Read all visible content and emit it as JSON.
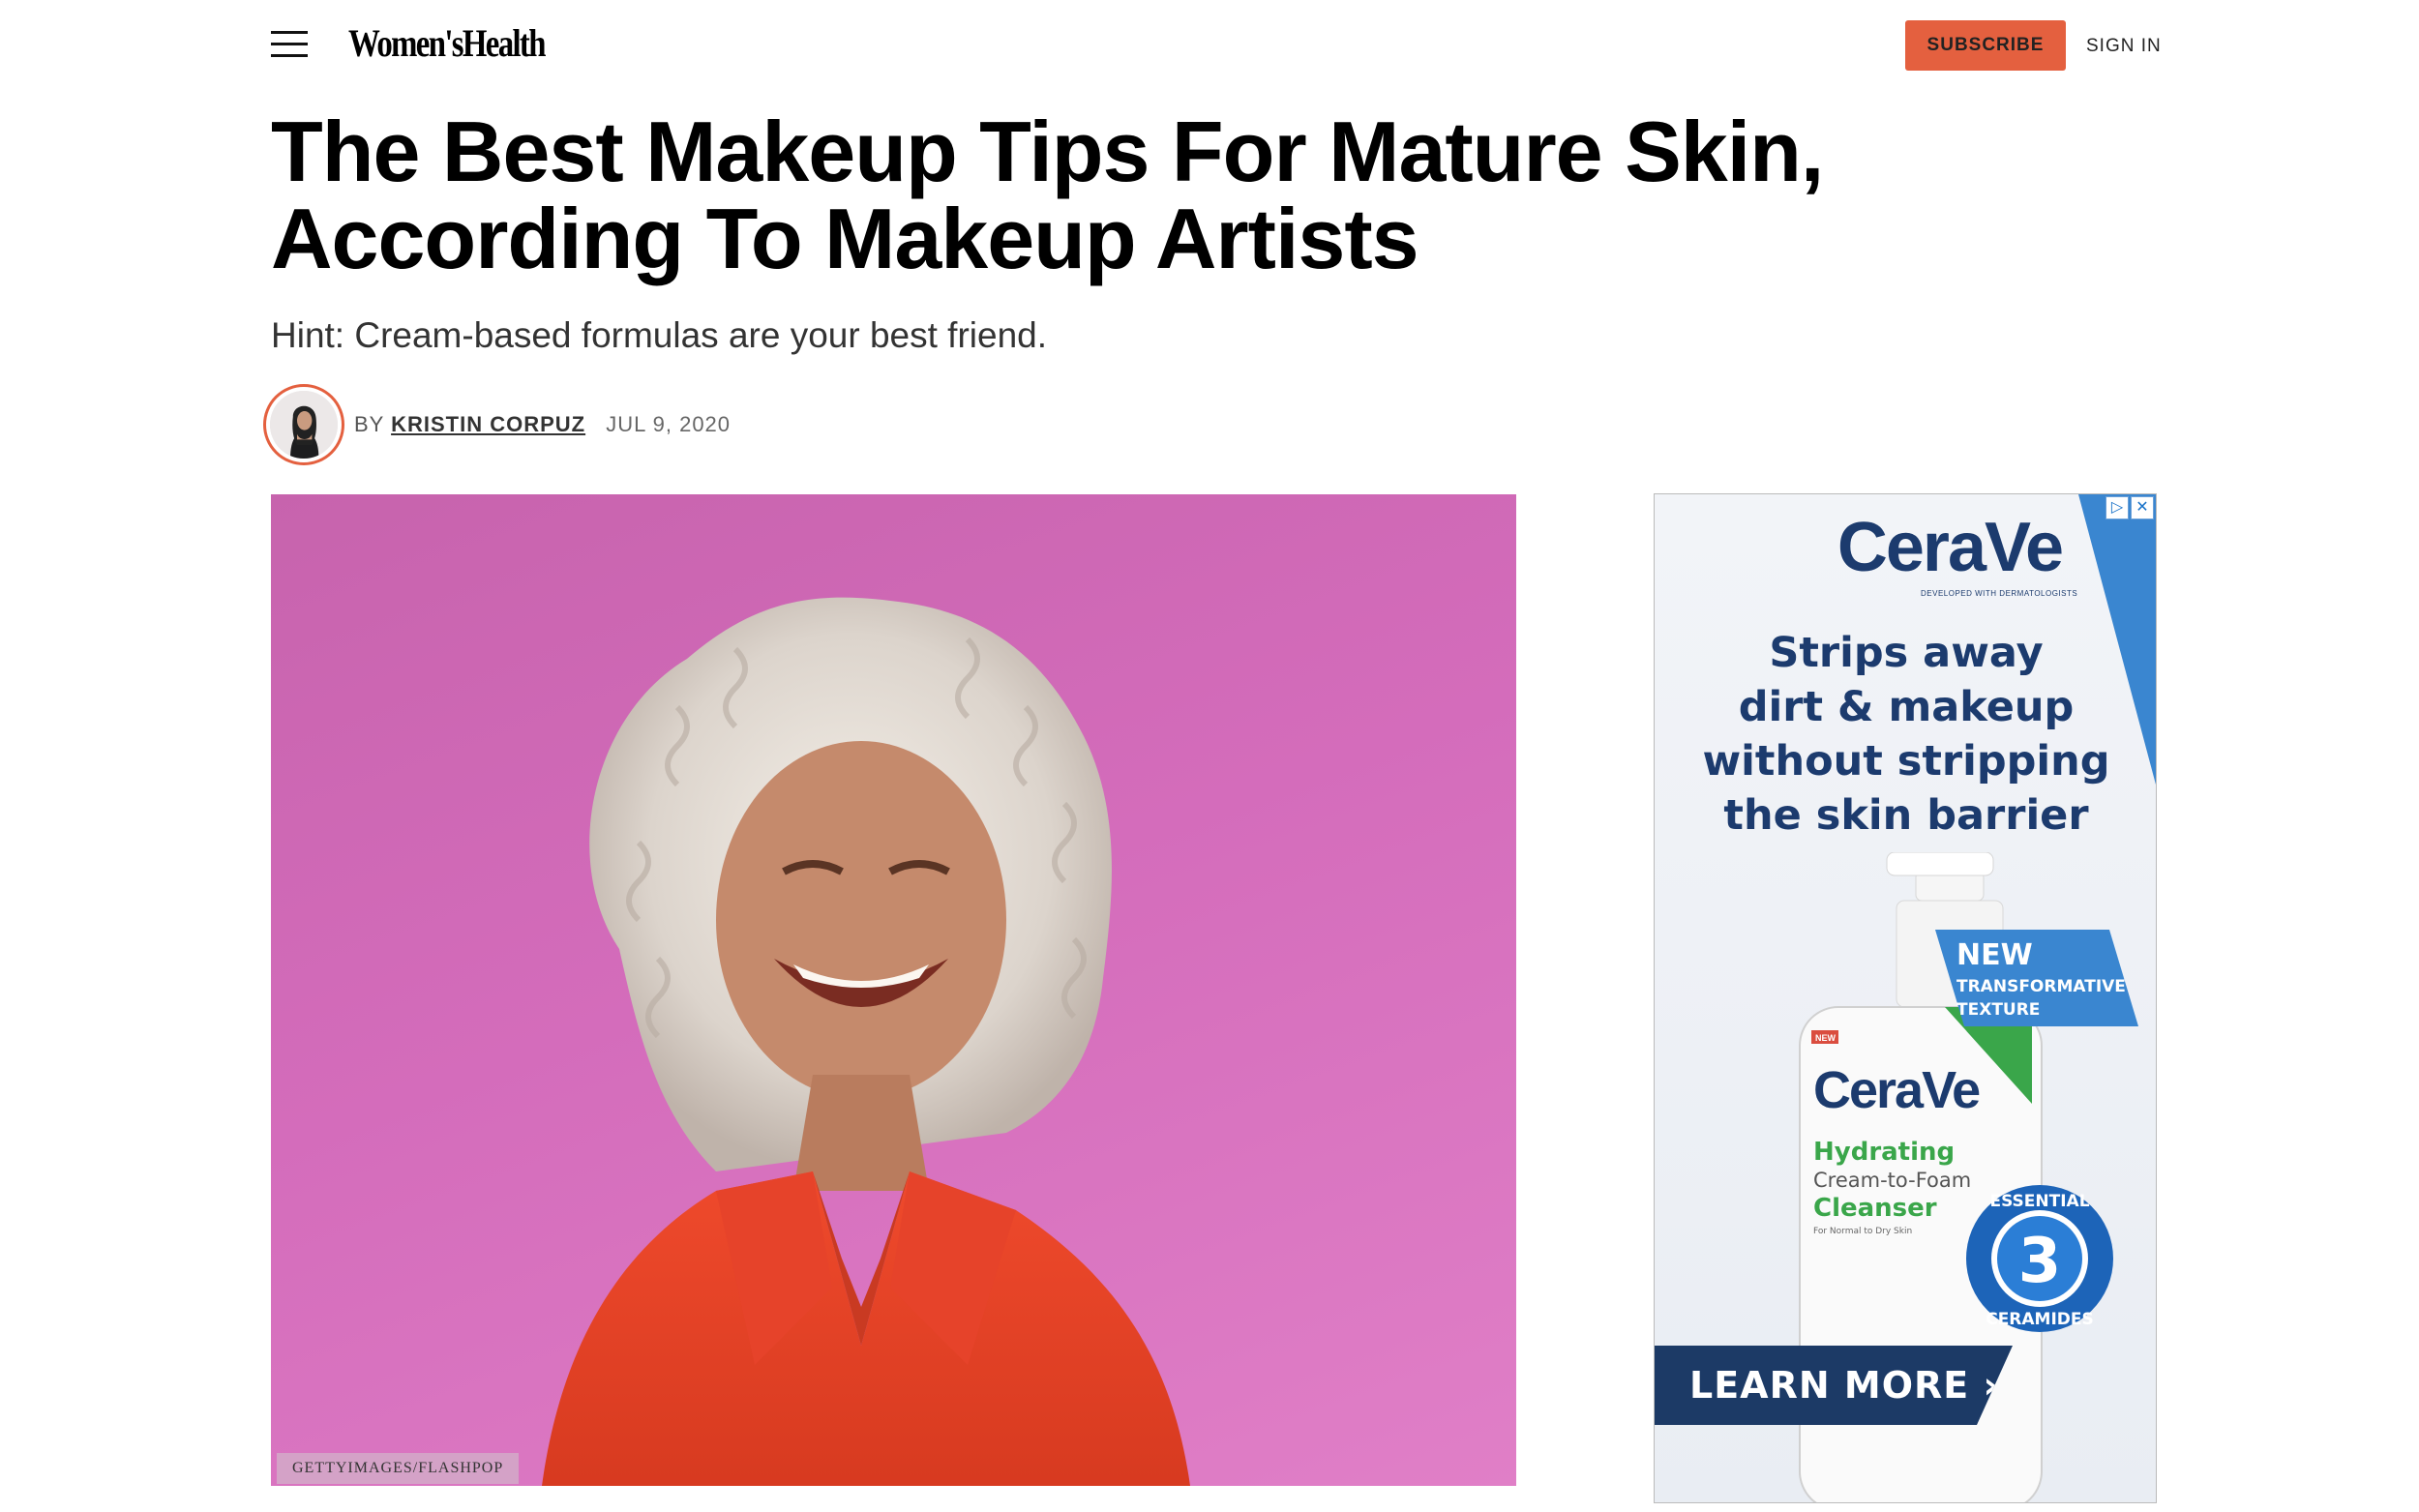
{
  "header": {
    "logo_text": "Women'sHealth",
    "subscribe_label": "SUBSCRIBE",
    "signin_label": "SIGN IN",
    "accent_color": "#e4603f"
  },
  "article": {
    "title": "The Best Makeup Tips For Mature Skin, According To Makeup Artists",
    "dek": "Hint: Cream-based formulas are your best friend.",
    "byline_prefix": "BY",
    "author": "KRISTIN CORPUZ",
    "date": "JUL 9, 2020",
    "image_credit": "GETTYIMAGES/FLASHPOP"
  },
  "ad": {
    "brand": "CeraVe",
    "brand_tagline": "DEVELOPED WITH DERMATOLOGISTS",
    "headline_lines": [
      "Strips away",
      "dirt & makeup",
      "without stripping",
      "the skin barrier"
    ],
    "new_label": "NEW",
    "new_sub_1": "TRANSFORMATIVE",
    "new_sub_2": "TEXTURE",
    "product_tag": "NEW",
    "product_name_1": "Hydrating",
    "product_name_2": "Cream-to-Foam",
    "product_name_3": "Cleanser",
    "product_note": "For Normal to Dry Skin",
    "badge_top": "ESSENTIAL",
    "badge_number": "3",
    "badge_bottom": "CERAMIDES",
    "cta_label": "LEARN MORE ›",
    "adchoices_icon": "adchoices-icon",
    "close_icon": "close-icon"
  }
}
